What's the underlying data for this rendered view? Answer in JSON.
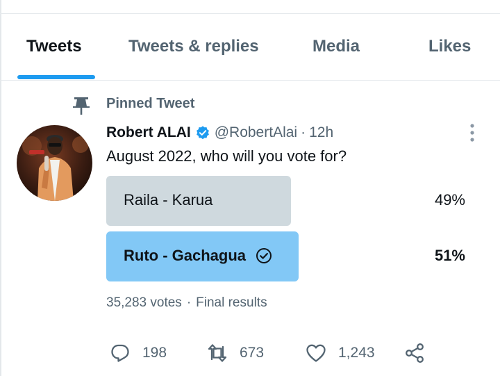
{
  "tabs": [
    {
      "label": "Tweets",
      "active": true
    },
    {
      "label": "Tweets & replies",
      "active": false
    },
    {
      "label": "Media",
      "active": false
    },
    {
      "label": "Likes",
      "active": false
    }
  ],
  "pinned": {
    "label": "Pinned Tweet",
    "icon": "pin-icon"
  },
  "tweet": {
    "author": "Robert ALAI",
    "handle": "@RobertAlai",
    "separator": "·",
    "time": "12h",
    "verified": true,
    "text": "August 2022, who will you vote for?"
  },
  "poll": {
    "options": [
      {
        "label": "Raila - Karua",
        "percent": "49%",
        "share": 0.49,
        "winner": false
      },
      {
        "label": "Ruto - Gachagua",
        "percent": "51%",
        "share": 0.51,
        "winner": true
      }
    ],
    "votes": "35,283 votes",
    "separator": "·",
    "status": "Final results"
  },
  "actions": {
    "replies": "198",
    "retweets": "673",
    "likes": "1,243"
  },
  "colors": {
    "accent": "#1d9bf0",
    "winner_bar": "#82c8f6",
    "loser_bar": "#cfd9de",
    "secondary_text": "#536471"
  },
  "icons": [
    "pin-icon",
    "verified-icon",
    "more-icon",
    "check-circle-icon",
    "reply-icon",
    "retweet-icon",
    "like-icon",
    "share-icon"
  ]
}
